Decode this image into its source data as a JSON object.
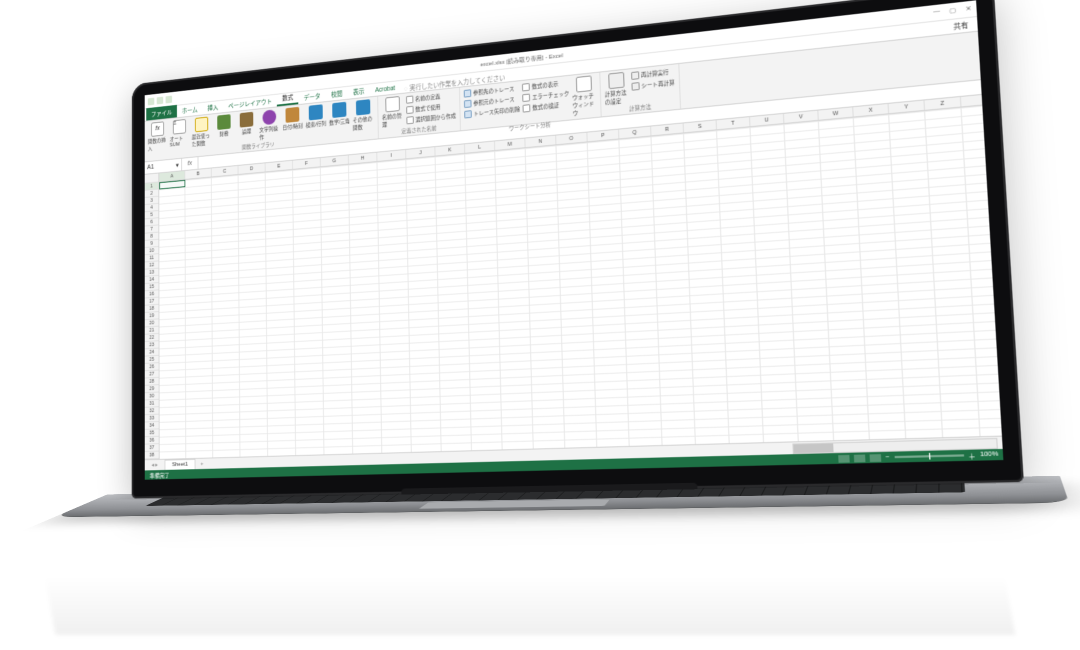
{
  "titlebar": {
    "doc": "excel.xlsx [読み取り専用] - Excel",
    "share": "共有"
  },
  "tabs": {
    "file": "ファイル",
    "items": [
      "ホーム",
      "挿入",
      "ページレイアウト",
      "数式",
      "データ",
      "校閲",
      "表示",
      "Acrobat"
    ],
    "active_index": 3,
    "tell_me": "実行したい作業を入力してください"
  },
  "ribbon": {
    "group1": {
      "label": "関数ライブラリ",
      "insert_fn": "関数の挿入",
      "autosum": "オートSUM",
      "recent": "最近使った関数",
      "financial": "財務",
      "logical": "論理",
      "text": "文字列操作",
      "date": "日付/時刻",
      "lookup": "検索/行列",
      "math": "数学/三角",
      "more": "その他の関数"
    },
    "group2": {
      "label": "定義された名前",
      "name_mgr": "名前の管理",
      "define": "名前の定義",
      "use": "数式で使用",
      "create": "選択範囲から作成"
    },
    "group3": {
      "label": "ワークシート分析",
      "precedents": "参照先のトレース",
      "dependents": "参照元のトレース",
      "remove": "トレース矢印の削除",
      "show_formula": "数式の表示",
      "error_check": "エラーチェック",
      "evaluate": "数式の検証",
      "watch": "ウォッチウィンドウ"
    },
    "group4": {
      "label": "計算方法",
      "options": "計算方法の設定",
      "calc_now": "再計算実行",
      "calc_sheet": "シート再計算"
    }
  },
  "formula_bar": {
    "name_box": "A1",
    "fx": "fx"
  },
  "columns": [
    "A",
    "B",
    "C",
    "D",
    "E",
    "F",
    "G",
    "H",
    "I",
    "J",
    "K",
    "L",
    "M",
    "N",
    "O",
    "P",
    "Q",
    "R",
    "S",
    "T",
    "U",
    "V",
    "W",
    "X",
    "Y",
    "Z"
  ],
  "row_count": 40,
  "sheet": {
    "name": "Sheet1",
    "add": "+"
  },
  "status": {
    "mode": "準備完了",
    "zoom": "100%"
  }
}
